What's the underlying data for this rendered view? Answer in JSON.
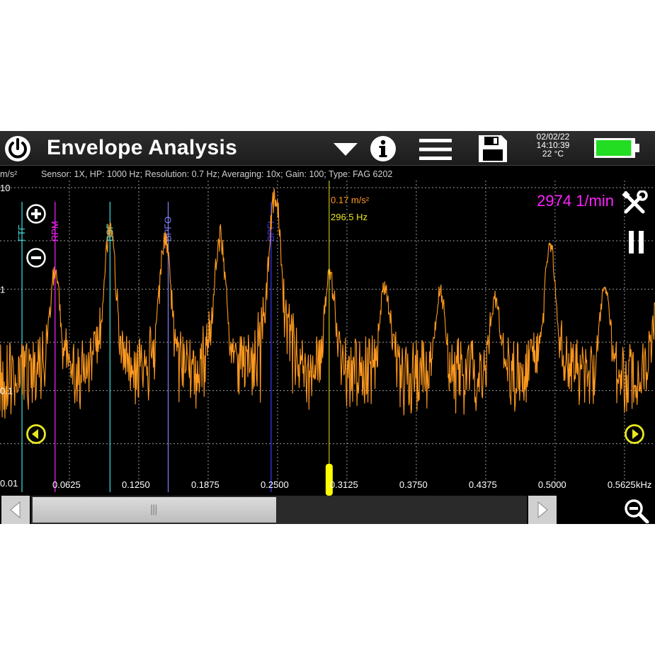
{
  "window": {
    "title": "Envelope Analysis"
  },
  "status": {
    "date": "02/02/22",
    "time": "14:10:39",
    "temperature": "22 °C",
    "battery_level": 0.95,
    "battery_color": "#22dd22"
  },
  "toolbar": {
    "power_icon": "power-icon",
    "dropdown_icon": "triangle-down-icon",
    "info_icon": "info-icon",
    "menu_icon": "hamburger-menu-icon",
    "save_icon": "floppy-disk-icon",
    "battery_icon": "battery-icon"
  },
  "info": {
    "unit": "m/s²",
    "params": "Sensor: 1X, HP: 1000 Hz; Resolution: 0.7 Hz; Averaging: 10x; Gain: 100; Type:  FAG 6202"
  },
  "speed": {
    "text": "2974 1/min",
    "color": "#ff22ff"
  },
  "cursor": {
    "amplitude": "0.17 m/s²",
    "frequency": "296.5 Hz",
    "amp_color": "#ff9a1f",
    "freq_color": "#e8e820"
  },
  "chart_data": {
    "type": "line",
    "x_unit": "kHz",
    "y_unit": "m/s²",
    "y_scale": "log",
    "ylim": [
      0.01,
      10
    ],
    "xlim": [
      0,
      0.59
    ],
    "x_ticks": [
      "0.0625",
      "0.1250",
      "0.1875",
      "0.2500",
      "0.3125",
      "0.3750",
      "0.4375",
      "0.5000",
      "0.5625"
    ],
    "x_tick_values": [
      0.0625,
      0.125,
      0.1875,
      0.25,
      0.3125,
      0.375,
      0.4375,
      0.5,
      0.5625
    ],
    "y_ticks": [
      "10",
      "1",
      "0.1",
      "0.01"
    ],
    "y_tick_values": [
      10,
      1,
      0.1,
      0.01
    ],
    "grid": true,
    "series": [
      {
        "color": "#ff9a1f",
        "peaks": [
          {
            "x": 0.0495,
            "y": 1.5
          },
          {
            "x": 0.0991,
            "y": 4.5
          },
          {
            "x": 0.1487,
            "y": 3.4
          },
          {
            "x": 0.1982,
            "y": 3.7
          },
          {
            "x": 0.2478,
            "y": 9.5
          },
          {
            "x": 0.2974,
            "y": 1.5
          },
          {
            "x": 0.3469,
            "y": 1.1
          },
          {
            "x": 0.3965,
            "y": 0.9
          },
          {
            "x": 0.446,
            "y": 0.8
          },
          {
            "x": 0.4956,
            "y": 3.0
          },
          {
            "x": 0.545,
            "y": 1.1
          },
          {
            "x": 0.5945,
            "y": 1.6
          }
        ],
        "noise_floor": 0.13
      }
    ],
    "markers": [
      {
        "label": "FTF",
        "x": 0.0198,
        "color": "#40e0e0"
      },
      {
        "label": "RPM",
        "x": 0.0496,
        "color": "#ff22ff"
      },
      {
        "label": "BSF",
        "x": 0.0991,
        "color": "#40e0e0"
      },
      {
        "label": "BPFO",
        "x": 0.1515,
        "color": "#7f7fff"
      },
      {
        "label": "BPFI",
        "x": 0.2442,
        "color": "#3a3aff"
      }
    ],
    "cursor_x": 0.2965
  },
  "bottom": {
    "left_icon": "arrow-left-icon",
    "right_icon": "arrow-right-icon",
    "zoom_out_icon": "zoom-out-icon",
    "scroll_grip": "|||"
  },
  "plot_icons": {
    "zoom_in": "plus-circle-icon",
    "zoom_out": "minus-circle-icon",
    "prev": "left-circle-icon",
    "next": "right-circle-icon",
    "tools": "tools-icon",
    "pause": "pause-icon"
  }
}
